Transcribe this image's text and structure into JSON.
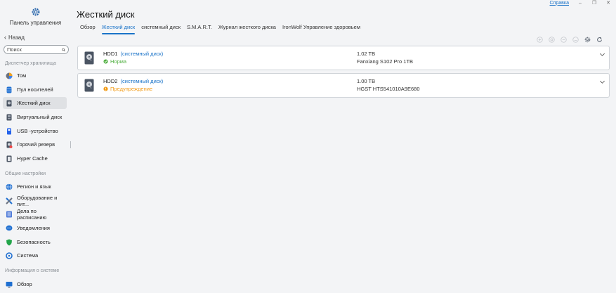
{
  "sidebar": {
    "title": "Панель управления",
    "back_label": "Назад",
    "search_placeholder": "Поиск",
    "sections": {
      "storage": "Диспетчер хранилища",
      "general": "Общие настройки",
      "sysinfo": "Информация о системе"
    },
    "items": [
      {
        "label": "Том"
      },
      {
        "label": "Пул носителей"
      },
      {
        "label": "Жесткий диск"
      },
      {
        "label": "Виртуальный диск"
      },
      {
        "label": "USB -устройство"
      },
      {
        "label": "Горячий резерв"
      },
      {
        "label": "Hyper Cache"
      },
      {
        "label": "Регион и язык"
      },
      {
        "label": "Оборудование и пит..."
      },
      {
        "label": "Дела по расписанию"
      },
      {
        "label": "Уведомления"
      },
      {
        "label": "Безопасность"
      },
      {
        "label": "Система"
      },
      {
        "label": "Обзор"
      }
    ]
  },
  "header": {
    "title": "Жесткий диск",
    "help_label": "Справка",
    "tabs": [
      {
        "label": "Обзор"
      },
      {
        "label": "Жесткий диск"
      },
      {
        "label": "системный диск"
      },
      {
        "label": "S.M.A.R.T."
      },
      {
        "label": "Журнал жесткого диска"
      },
      {
        "label": "IronWolf Управление здоровьем"
      }
    ]
  },
  "disks": [
    {
      "name": "HDD1",
      "tag": "(системный диск)",
      "status": "Норма",
      "status_color": "#52b043",
      "capacity": "1.02 TB",
      "model": "Fanxiang S102 Pro 1TB"
    },
    {
      "name": "HDD2",
      "tag": "(системный диск)",
      "status": "Предупреждение",
      "status_color": "#f29b17",
      "capacity": "1.00 TB",
      "model": "HGST HTS541010A9E680"
    }
  ],
  "colors": {
    "accent": "#1a73c8",
    "ok": "#52b043",
    "warn": "#f29b17"
  }
}
